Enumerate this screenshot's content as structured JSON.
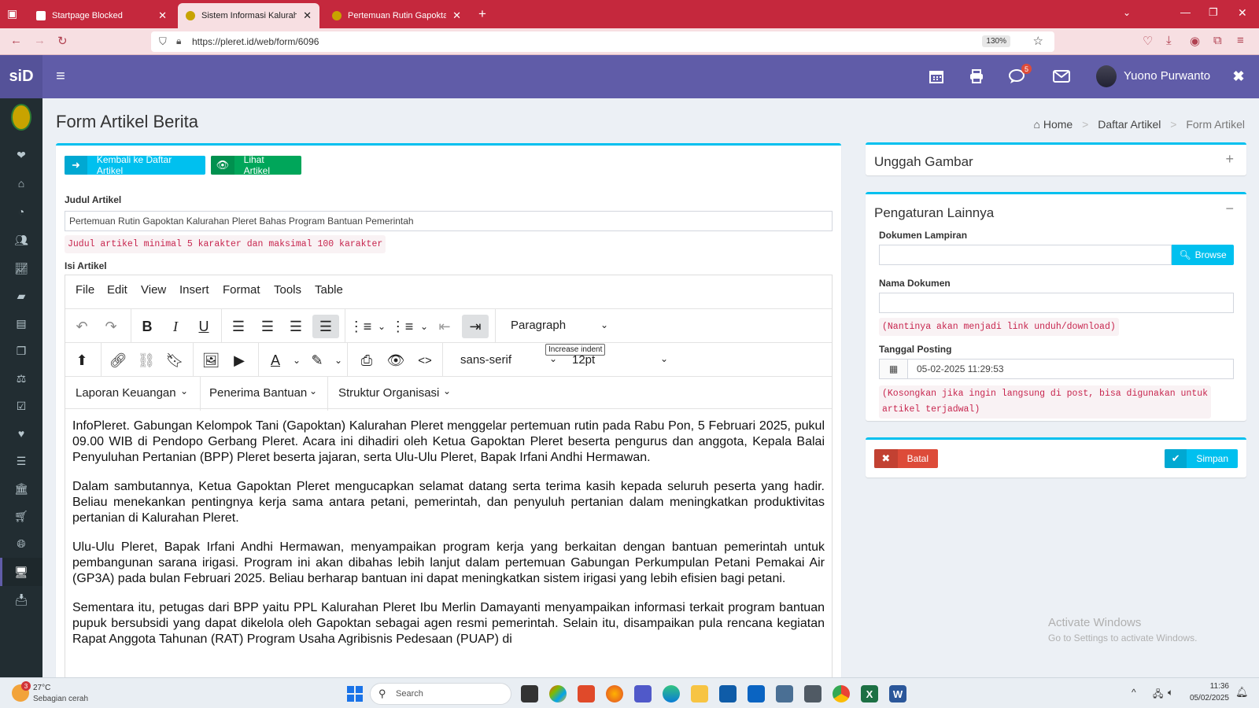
{
  "browser": {
    "tabs": [
      {
        "label": "Startpage Blocked",
        "active": false
      },
      {
        "label": "Sistem Informasi Kalurahan Pleret",
        "active": true
      },
      {
        "label": "Pertemuan Rutin Gapoktan Kalurahan",
        "active": false
      }
    ],
    "url": "https://pleret.id/web/form/6096",
    "zoom": "130%"
  },
  "app": {
    "logo": "siD",
    "user_name": "Yuono Purwanto",
    "message_count": "5"
  },
  "page": {
    "title": "Form Artikel Berita",
    "breadcrumb": {
      "home": "Home",
      "list": "Daftar Artikel",
      "current": "Form Artikel"
    }
  },
  "form": {
    "back_button": "Kembali ke Daftar Artikel",
    "view_button": "Lihat Artikel",
    "title_label": "Judul Artikel",
    "title_value": "Pertemuan Rutin Gapoktan Kalurahan Pleret Bahas Program Bantuan Pemerintah",
    "title_hint": "Judul artikel minimal 5 karakter dan maksimal 100 karakter",
    "content_label": "Isi Artikel"
  },
  "editor": {
    "menus": [
      "File",
      "Edit",
      "View",
      "Insert",
      "Format",
      "Tools",
      "Table"
    ],
    "block_format": "Paragraph",
    "font_family": "sans-serif",
    "font_size": "12pt",
    "tooltip": "Increase indent",
    "custom_menus": [
      "Laporan Keuangan",
      "Penerima Bantuan",
      "Struktur Organisasi"
    ],
    "paragraphs": [
      "InfoPleret. Gabungan Kelompok Tani (Gapoktan) Kalurahan Pleret menggelar pertemuan rutin pada Rabu Pon, 5 Februari 2025, pukul 09.00 WIB di Pendopo Gerbang Pleret. Acara ini dihadiri oleh Ketua Gapoktan Pleret beserta pengurus dan anggota, Kepala Balai Penyuluhan Pertanian (BPP) Pleret beserta jajaran, serta Ulu-Ulu Pleret, Bapak Irfani Andhi Hermawan.",
      "Dalam sambutannya, Ketua Gapoktan Pleret mengucapkan selamat datang serta terima kasih kepada seluruh peserta yang hadir. Beliau menekankan pentingnya kerja sama antara petani, pemerintah, dan penyuluh pertanian dalam meningkatkan produktivitas pertanian di Kalurahan Pleret.",
      "Ulu-Ulu Pleret, Bapak Irfani Andhi Hermawan, menyampaikan program kerja yang berkaitan dengan bantuan pemerintah untuk pembangunan sarana irigasi. Program ini akan dibahas lebih lanjut dalam pertemuan Gabungan Perkumpulan Petani Pemakai Air (GP3A) pada bulan Februari 2025. Beliau berharap bantuan ini dapat meningkatkan sistem irigasi yang lebih efisien bagi petani.",
      "Sementara itu, petugas dari BPP yaitu PPL Kalurahan Pleret Ibu Merlin Damayanti  menyampaikan informasi terkait program bantuan pupuk bersubsidi yang dapat dikelola oleh Gapoktan sebagai agen resmi pemerintah. Selain itu, disampaikan pula rencana kegiatan Rapat Anggota Tahunan (RAT) Program Usaha Agribisnis Pedesaan (PUAP) di"
    ]
  },
  "upload_box": {
    "title": "Unggah Gambar"
  },
  "settings_box": {
    "title": "Pengaturan Lainnya",
    "attachment_label": "Dokumen Lampiran",
    "browse_button": "Browse",
    "doc_name_label": "Nama Dokumen",
    "doc_name_hint": "(Nantinya akan menjadi link unduh/download)",
    "post_date_label": "Tanggal Posting",
    "post_date_value": "05-02-2025 11:29:53",
    "post_date_hint_1": "(Kosongkan jika ingin langsung di post, bisa digunakan untuk",
    "post_date_hint_2": "artikel terjadwal)"
  },
  "actions": {
    "cancel": "Batal",
    "save": "Simpan"
  },
  "watermark": {
    "line1": "Activate Windows",
    "line2": "Go to Settings to activate Windows."
  },
  "taskbar": {
    "temperature": "27°C",
    "weather": "Sebagian cerah",
    "weather_badge": "3",
    "search_placeholder": "Search",
    "time": "11:36",
    "date": "05/02/2025"
  },
  "colors": {
    "header": "#605ca8",
    "sidebar": "#222d32",
    "accent": "#00c0ef",
    "success": "#00a65a",
    "danger": "#dd4b39"
  }
}
